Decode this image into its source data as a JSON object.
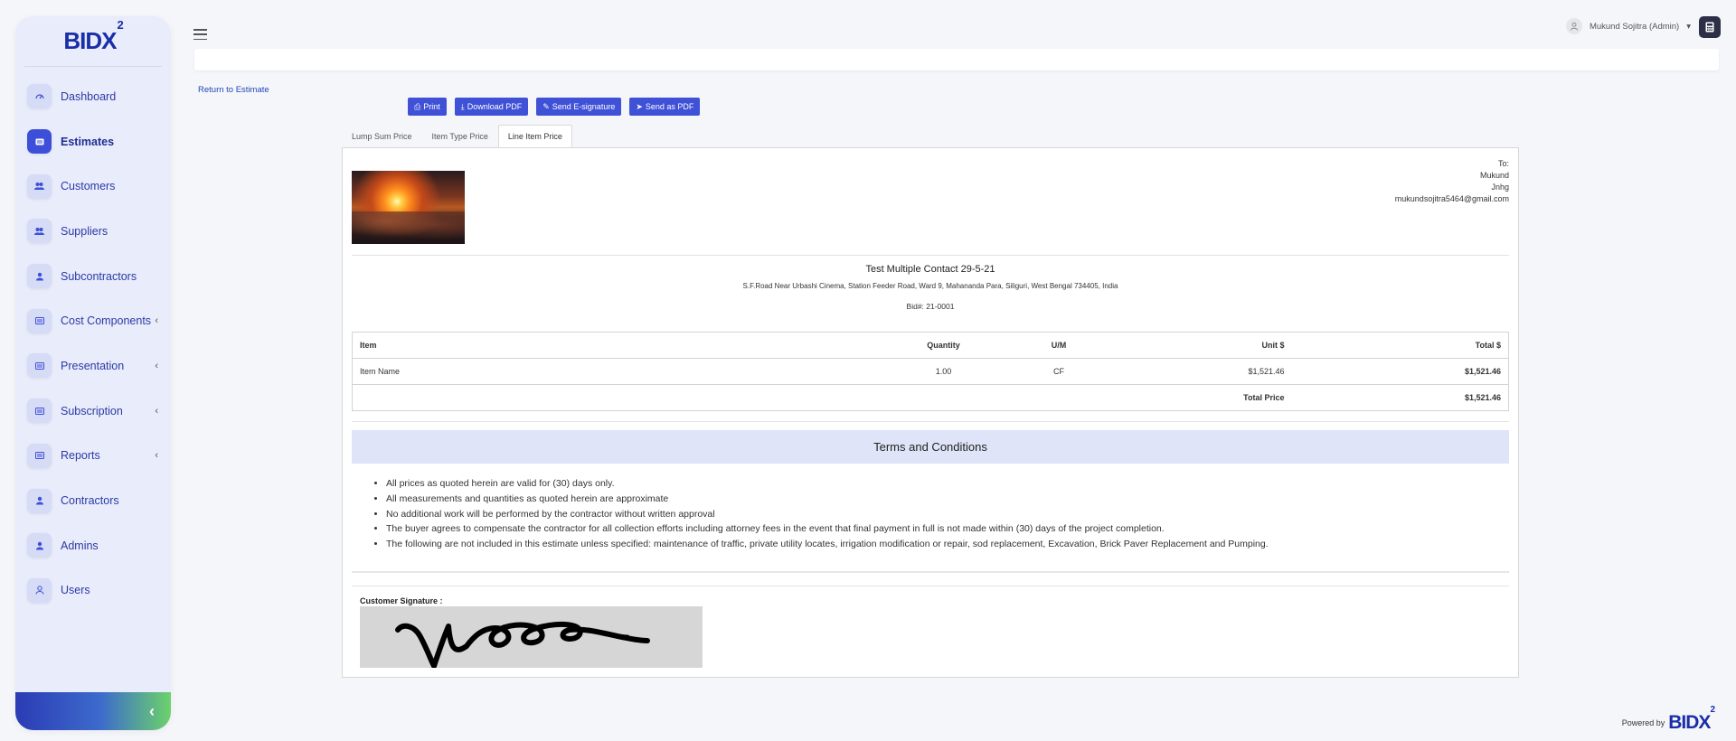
{
  "brand": {
    "name": "BIDX",
    "superscript": "2"
  },
  "sidebar": {
    "items": [
      {
        "label": "Dashboard",
        "icon": "dashboard-icon",
        "active": false,
        "caret": ""
      },
      {
        "label": "Estimates",
        "icon": "estimate-icon",
        "active": true,
        "caret": ""
      },
      {
        "label": "Customers",
        "icon": "users-icon",
        "active": false,
        "caret": ""
      },
      {
        "label": "Suppliers",
        "icon": "users-icon",
        "active": false,
        "caret": ""
      },
      {
        "label": "Subcontractors",
        "icon": "user-icon",
        "active": false,
        "caret": ""
      },
      {
        "label": "Cost Components",
        "icon": "list-icon",
        "active": false,
        "caret": "‹"
      },
      {
        "label": "Presentation",
        "icon": "list-icon",
        "active": false,
        "caret": "‹"
      },
      {
        "label": "Subscription",
        "icon": "list-icon",
        "active": false,
        "caret": "‹"
      },
      {
        "label": "Reports",
        "icon": "list-icon",
        "active": false,
        "caret": "‹"
      },
      {
        "label": "Contractors",
        "icon": "user-icon",
        "active": false,
        "caret": ""
      },
      {
        "label": "Admins",
        "icon": "user-icon",
        "active": false,
        "caret": ""
      },
      {
        "label": "Users",
        "icon": "user-outline-icon",
        "active": false,
        "caret": ""
      }
    ],
    "collapse_glyph": "‹"
  },
  "header": {
    "user_name": "Mukund Sojitra (Admin)",
    "user_caret": "▾"
  },
  "return_link": "Return to Estimate",
  "actions": {
    "print": "Print",
    "download_pdf": "Download PDF",
    "send_esignature": "Send E-signature",
    "send_pdf": "Send as PDF"
  },
  "tabs": [
    "Lump Sum Price",
    "Item Type Price",
    "Line Item Price"
  ],
  "active_tab": 2,
  "document": {
    "to": {
      "label": "To:",
      "name": "Mukund",
      "line2": "Jnhg",
      "email": "mukundsojitra5464@gmail.com"
    },
    "project_title": "Test Multiple Contact 29-5-21",
    "address": "S.F.Road Near Urbashi Cinema, Station Feeder Road, Ward 9, Mahananda Para, Siliguri, West Bengal 734405, India",
    "bid": "Bid#: 21-0001",
    "table": {
      "headers": {
        "item": "Item",
        "quantity": "Quantity",
        "um": "U/M",
        "unit": "Unit $",
        "total": "Total $"
      },
      "rows": [
        {
          "item": "Item Name",
          "quantity": "1.00",
          "um": "CF",
          "unit": "$1,521.46",
          "total": "$1,521.46"
        }
      ],
      "total_label": "Total Price",
      "total_value": "$1,521.46"
    },
    "terms_title": "Terms and Conditions",
    "terms": [
      "All prices as quoted herein are valid for (30) days only.",
      "All measurements and quantities as quoted herein are approximate",
      "No additional work will be performed by the contractor without written approval",
      "The buyer agrees to compensate the contractor for all collection efforts including attorney fees in the event that final payment in full is not made within (30) days of the project completion.",
      "The following are not included in this estimate unless specified: maintenance of traffic, private utility locates, irrigation modification or repair, sod replacement, Excavation, Brick Paver Replacement and Pumping."
    ],
    "signature_label": "Customer Signature :"
  },
  "footer": {
    "powered_by": "Powered by",
    "logo": "BIDX",
    "logo_sup": "2"
  },
  "colors": {
    "accent": "#3f51d6",
    "brand": "#1a2ea8",
    "terms_bg": "#dfe4f8"
  }
}
